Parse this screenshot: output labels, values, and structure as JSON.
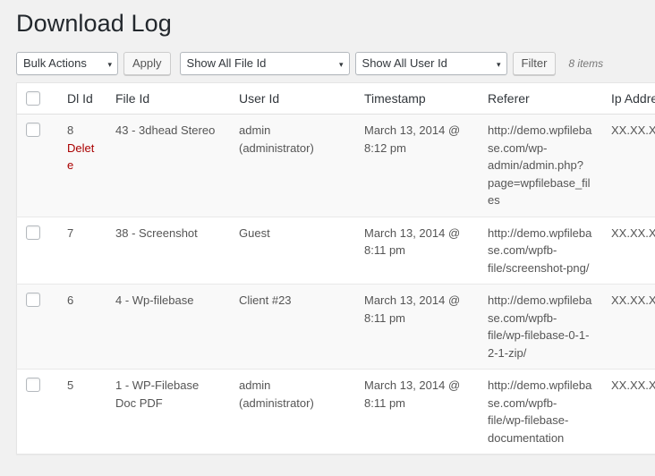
{
  "page": {
    "title": "Download Log"
  },
  "toolbar": {
    "bulk_actions_label": "Bulk Actions",
    "apply_label": "Apply",
    "file_id_filter_label": "Show All File Id",
    "user_id_filter_label": "Show All User Id",
    "filter_label": "Filter",
    "items_count": "8 items",
    "dropdown_arrow": "▾"
  },
  "table": {
    "columns": [
      {
        "key": "cb",
        "label": ""
      },
      {
        "key": "dl_id",
        "label": "Dl Id"
      },
      {
        "key": "file_id",
        "label": "File Id"
      },
      {
        "key": "user_id",
        "label": "User Id"
      },
      {
        "key": "timestamp",
        "label": "Timestamp"
      },
      {
        "key": "referer",
        "label": "Referer"
      },
      {
        "key": "ip_address",
        "label": "Ip Address"
      }
    ],
    "rows": [
      {
        "dl_id": "8",
        "delete_label": "Delete",
        "file_id": "43 - 3dhead Stereo",
        "user_id": "admin (administrator)",
        "timestamp": "March 13, 2014 @ 8:12 pm",
        "referer": "http://demo.wpfilebase.com/wp-admin/admin.php?page=wpfilebase_files",
        "ip_address": "XX.XX.XX.XX"
      },
      {
        "dl_id": "7",
        "delete_label": "",
        "file_id": "38 - Screenshot",
        "user_id": "Guest",
        "timestamp": "March 13, 2014 @ 8:11 pm",
        "referer": "http://demo.wpfilebase.com/wpfb-file/screenshot-png/",
        "ip_address": "XX.XX.XX.XX"
      },
      {
        "dl_id": "6",
        "delete_label": "",
        "file_id": "4 - Wp-filebase",
        "user_id": "Client #23",
        "timestamp": "March 13, 2014 @ 8:11 pm",
        "referer": "http://demo.wpfilebase.com/wpfb-file/wp-filebase-0-1-2-1-zip/",
        "ip_address": "XX.XX.XX.XX"
      },
      {
        "dl_id": "5",
        "delete_label": "",
        "file_id": "1 - WP-Filebase Doc PDF",
        "user_id": "admin (administrator)",
        "timestamp": "March 13, 2014 @ 8:11 pm",
        "referer": "http://demo.wpfilebase.com/wpfb-file/wp-filebase-documentation",
        "ip_address": "XX.XX.XX.XX"
      }
    ]
  },
  "colors": {
    "page_background": "#f1f1f1",
    "table_background": "#ffffff",
    "alt_row_background": "#f9f9f9",
    "delete_link": "#aa0000",
    "heading_text": "#23282d",
    "body_text": "#555555"
  }
}
